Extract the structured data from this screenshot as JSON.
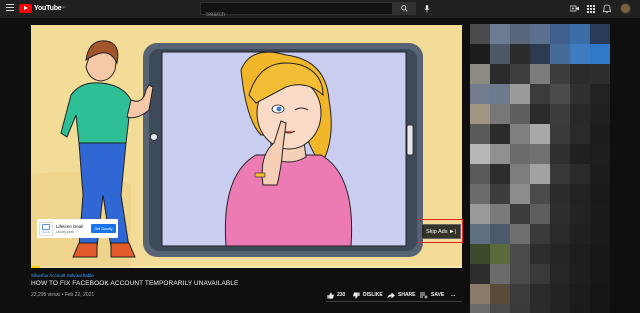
{
  "header": {
    "logo_text": "YouTube",
    "logo_region": "IN",
    "search_placeholder": "Search"
  },
  "player": {
    "ad_card": {
      "title": "Lifetime Deal!",
      "subtitle": "cloudy.park",
      "cta": "Get Cloudly",
      "logo_text": "Cloudly"
    },
    "skip_label": "Skip Ads ►|",
    "ad_progress": 0.02
  },
  "video": {
    "channel": "Silverfox Account Solvouchable",
    "title": "HOW TO FIX FACEBOOK ACCOUNT TEMPORARILY UNAVAILABLE",
    "views": "22,295 views",
    "date": "Feb 22, 2021",
    "likes": "230",
    "dislike_label": "DISLIKE",
    "share_label": "SHARE",
    "save_label": "SAVE",
    "more_label": "..."
  },
  "colors": {
    "accent_red": "#ff0000",
    "highlight_box": "#e0261c",
    "link_blue": "#3ea6ff"
  },
  "sidebar_blurred": [
    [
      "#4a4a4a",
      "#6c7c93",
      "#58657a",
      "#5c6f8e",
      "#3f5f91",
      "#3a6ea8",
      "#2a3b57"
    ],
    [
      "#1d1d1d",
      "#4d5866",
      "#2c2c2c",
      "#2d3b50",
      "#456b96",
      "#3f7cc1",
      "#3178c8"
    ],
    [
      "#8d8a80",
      "#2a2a2a",
      "#3e3e3e",
      "#7b7b7b",
      "#3d3d3d",
      "#2b2b2b",
      "#2e2e2e"
    ],
    [
      "#737c8d",
      "#6c7a8e",
      "#9a9a9a",
      "#3b3b3b",
      "#4b4b4b",
      "#303030",
      "#222222"
    ],
    [
      "#a39680",
      "#777777",
      "#5f5f5f",
      "#2b2b2b",
      "#3c3c3c",
      "#282828",
      "#202020"
    ],
    [
      "#5a5a5a",
      "#2b2b2b",
      "#7f7f7f",
      "#a9a9a9",
      "#3a3a3a",
      "#2a2a2a",
      "#1c1c1c"
    ],
    [
      "#b7b7b7",
      "#8f9090",
      "#6a6a6a",
      "#717171",
      "#2f2f2f",
      "#202020",
      "#1e1e1e"
    ],
    [
      "#595959",
      "#2d2d2d",
      "#7d7d7d",
      "#a2a2a2",
      "#383838",
      "#2a2a2a",
      "#1c1c1c"
    ],
    [
      "#6b6b6b",
      "#3d3d3d",
      "#8c8c8c",
      "#4a4a4a",
      "#2c2c2c",
      "#222222",
      "#1a1a1a"
    ],
    [
      "#9a9a9a",
      "#7a7a7a",
      "#3b3b3b",
      "#5e5e5e",
      "#2e2e2e",
      "#232323",
      "#1b1b1b"
    ],
    [
      "#5d6f80",
      "#4a5a6a",
      "#6e6e6e",
      "#3a3a3a",
      "#2a2a2a",
      "#212121",
      "#1a1a1a"
    ],
    [
      "#3b4a2a",
      "#5a6a3a",
      "#4b4b4b",
      "#2d2d2d",
      "#242424",
      "#1e1e1e",
      "#181818"
    ],
    [
      "#2d2d2d",
      "#6b6b6b",
      "#4a4a4a",
      "#393939",
      "#262626",
      "#1f1f1f",
      "#171717"
    ],
    [
      "#8a7a6a",
      "#5a4a3a",
      "#3c3c3c",
      "#2a2a2a",
      "#232323",
      "#1c1c1c",
      "#161616"
    ],
    [
      "#6a6a6a",
      "#4a4a4a",
      "#3a3a3a",
      "#2b2b2b",
      "#222222",
      "#1b1b1b",
      "#151515"
    ]
  ]
}
